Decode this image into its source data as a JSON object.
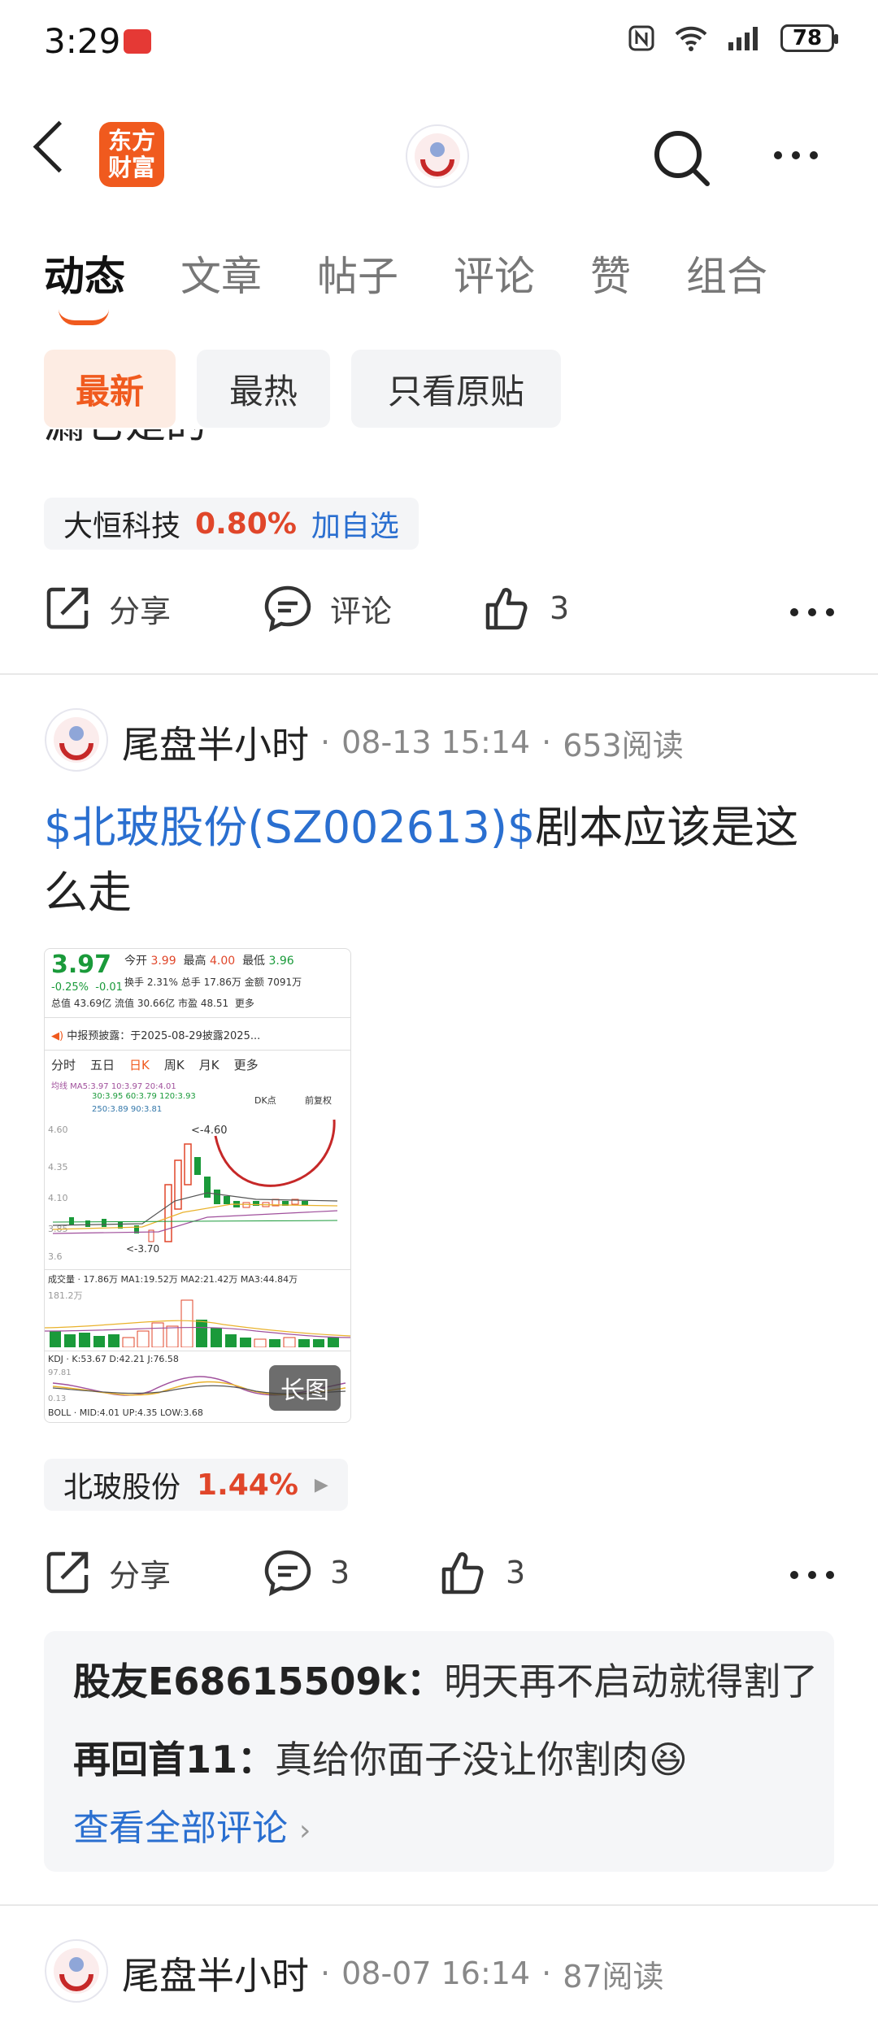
{
  "status_bar": {
    "time": "3:29",
    "battery": "78"
  },
  "header": {
    "logo_line1": "东方",
    "logo_line2": "财富"
  },
  "tabs": [
    {
      "label": "动态",
      "active": true
    },
    {
      "label": "文章"
    },
    {
      "label": "帖子"
    },
    {
      "label": "评论"
    },
    {
      "label": "赞"
    },
    {
      "label": "组合"
    }
  ],
  "filters": [
    {
      "label": "最新",
      "active": true
    },
    {
      "label": "最热"
    },
    {
      "label": "只看原贴"
    }
  ],
  "prev_post": {
    "partial_text": "漏它是的",
    "stock": {
      "name": "大恒科技",
      "change": "0.80%",
      "action": "加自选"
    },
    "actions": {
      "share": "分享",
      "comment": "评论",
      "likes": "3"
    }
  },
  "post": {
    "author": "尾盘半小时",
    "date": "08-13 15:14",
    "reads": "653阅读",
    "tag": "$北玻股份(SZ002613)$",
    "text": "剧本应该是这么走",
    "thumb": {
      "price": "3.97",
      "pct": "-0.25%",
      "chg": "-0.01",
      "open_label": "今开",
      "open": "3.99",
      "high_label": "最高",
      "high": "4.00",
      "low_label": "最低",
      "low": "3.96",
      "turnover": "换手 2.31%",
      "volume": "总手 17.86万",
      "amount": "金额 7091万",
      "mcap": "总值 43.69亿",
      "float": "流值 30.66亿",
      "pe": "市盈 48.51",
      "more": "更多",
      "notice": "中报预披露：于2025-08-29披露2025...",
      "periods": [
        "分时",
        "五日",
        "日K",
        "周K",
        "月K",
        "更多"
      ],
      "ma_line": "均线 MA5:3.97 10:3.97 20:4.01",
      "ma_line2": "30:3.95 60:3.79 120:3.93",
      "ma_line3": "250:3.89 90:3.81",
      "dk": "DK点",
      "fq": "前复权",
      "hi_mark": "<-4.60",
      "lo_mark": "<-3.70",
      "y_top": "4.60",
      "y2": "4.35",
      "y3": "4.10",
      "y4": "3.85",
      "y_bot": "3.6",
      "vol_label": "成交量 · 17.86万 MA1:19.52万 MA2:21.42万 MA3:44.84万",
      "vol_max": "181.2万",
      "kdj": "KDJ · K:53.67 D:42.21 J:76.58",
      "kdj_top": "97.81",
      "kdj_bot": "0.13",
      "boll": "BOLL · MID:4.01 UP:4.35 LOW:3.68",
      "long_label": "长图"
    },
    "stock": {
      "name": "北玻股份",
      "change": "1.44%"
    },
    "actions": {
      "share": "分享",
      "comments": "3",
      "likes": "3"
    },
    "comments": [
      {
        "user": "股友E68615509k",
        "text": "明天再不启动就得割了"
      },
      {
        "user": "再回首11",
        "text": "真给你面子没让你割肉",
        "emoji": "😆"
      }
    ],
    "view_all": "查看全部评论"
  },
  "next_post": {
    "author": "尾盘半小时",
    "date": "08-07 16:14",
    "reads": "87阅读"
  },
  "colors": {
    "brand": "#f05a1e",
    "link": "#2a6fd0",
    "up": "#e0462a",
    "down": "#1a9a3a"
  }
}
